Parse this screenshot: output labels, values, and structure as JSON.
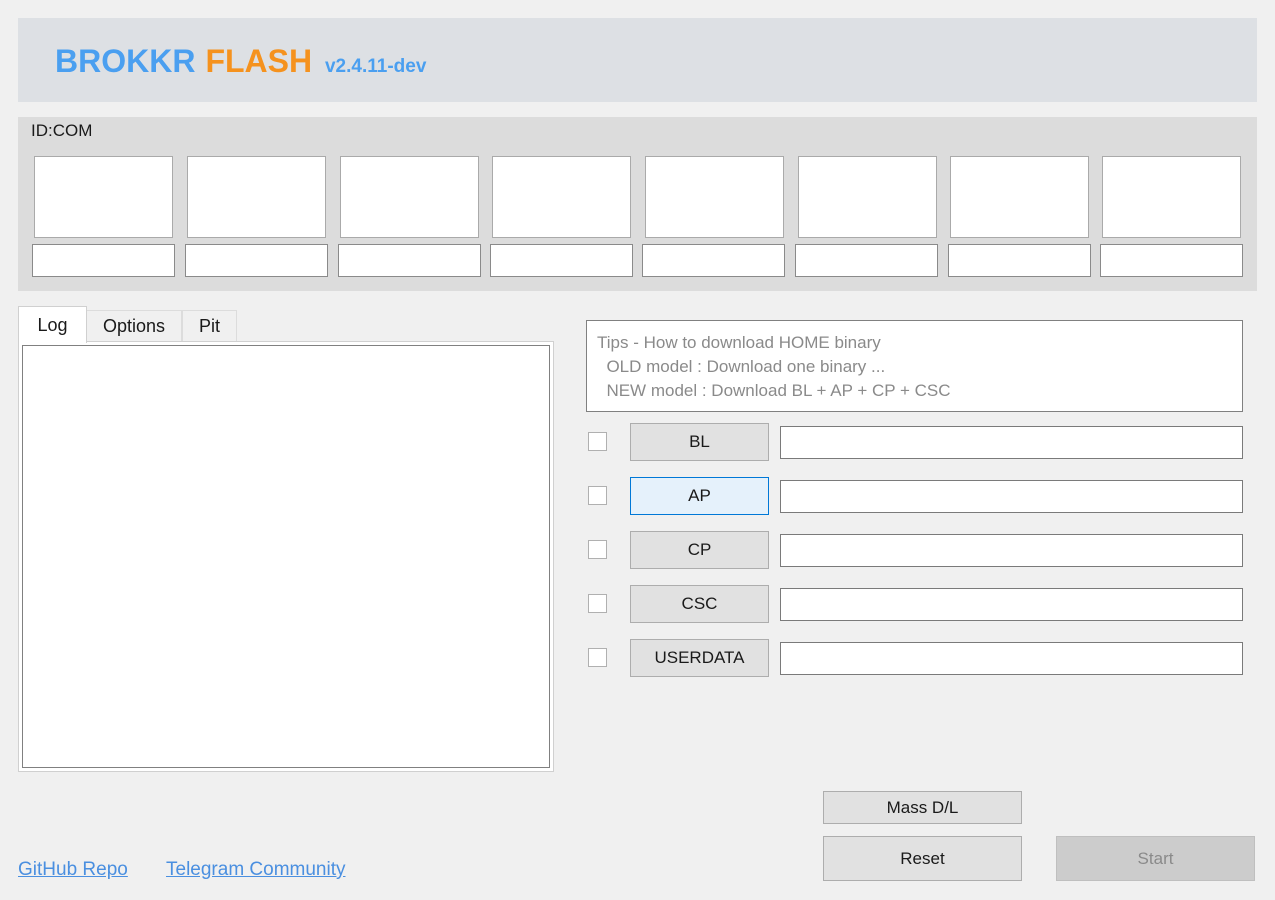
{
  "header": {
    "brand_primary": "BROKKR",
    "brand_secondary": "FLASH",
    "version": "v2.4.11-dev"
  },
  "id_com": {
    "label": "ID:COM"
  },
  "tabs": [
    {
      "label": "Log"
    },
    {
      "label": "Options"
    },
    {
      "label": "Pit"
    }
  ],
  "tips": {
    "line1": "Tips - How to download HOME binary",
    "line2": "  OLD model : Download one binary ...",
    "line3": "  NEW model : Download BL + AP + CP + CSC"
  },
  "files": [
    {
      "label": "BL"
    },
    {
      "label": "AP"
    },
    {
      "label": "CP"
    },
    {
      "label": "CSC"
    },
    {
      "label": "USERDATA"
    }
  ],
  "actions": {
    "mass_dl": "Mass D/L",
    "reset": "Reset",
    "start": "Start"
  },
  "links": {
    "github": "GitHub Repo",
    "telegram": "Telegram Community"
  },
  "colors": {
    "brand_blue": "#4a9ff0",
    "brand_orange": "#f5921e",
    "link": "#4a8fe0",
    "focus_border": "#0078d7"
  }
}
